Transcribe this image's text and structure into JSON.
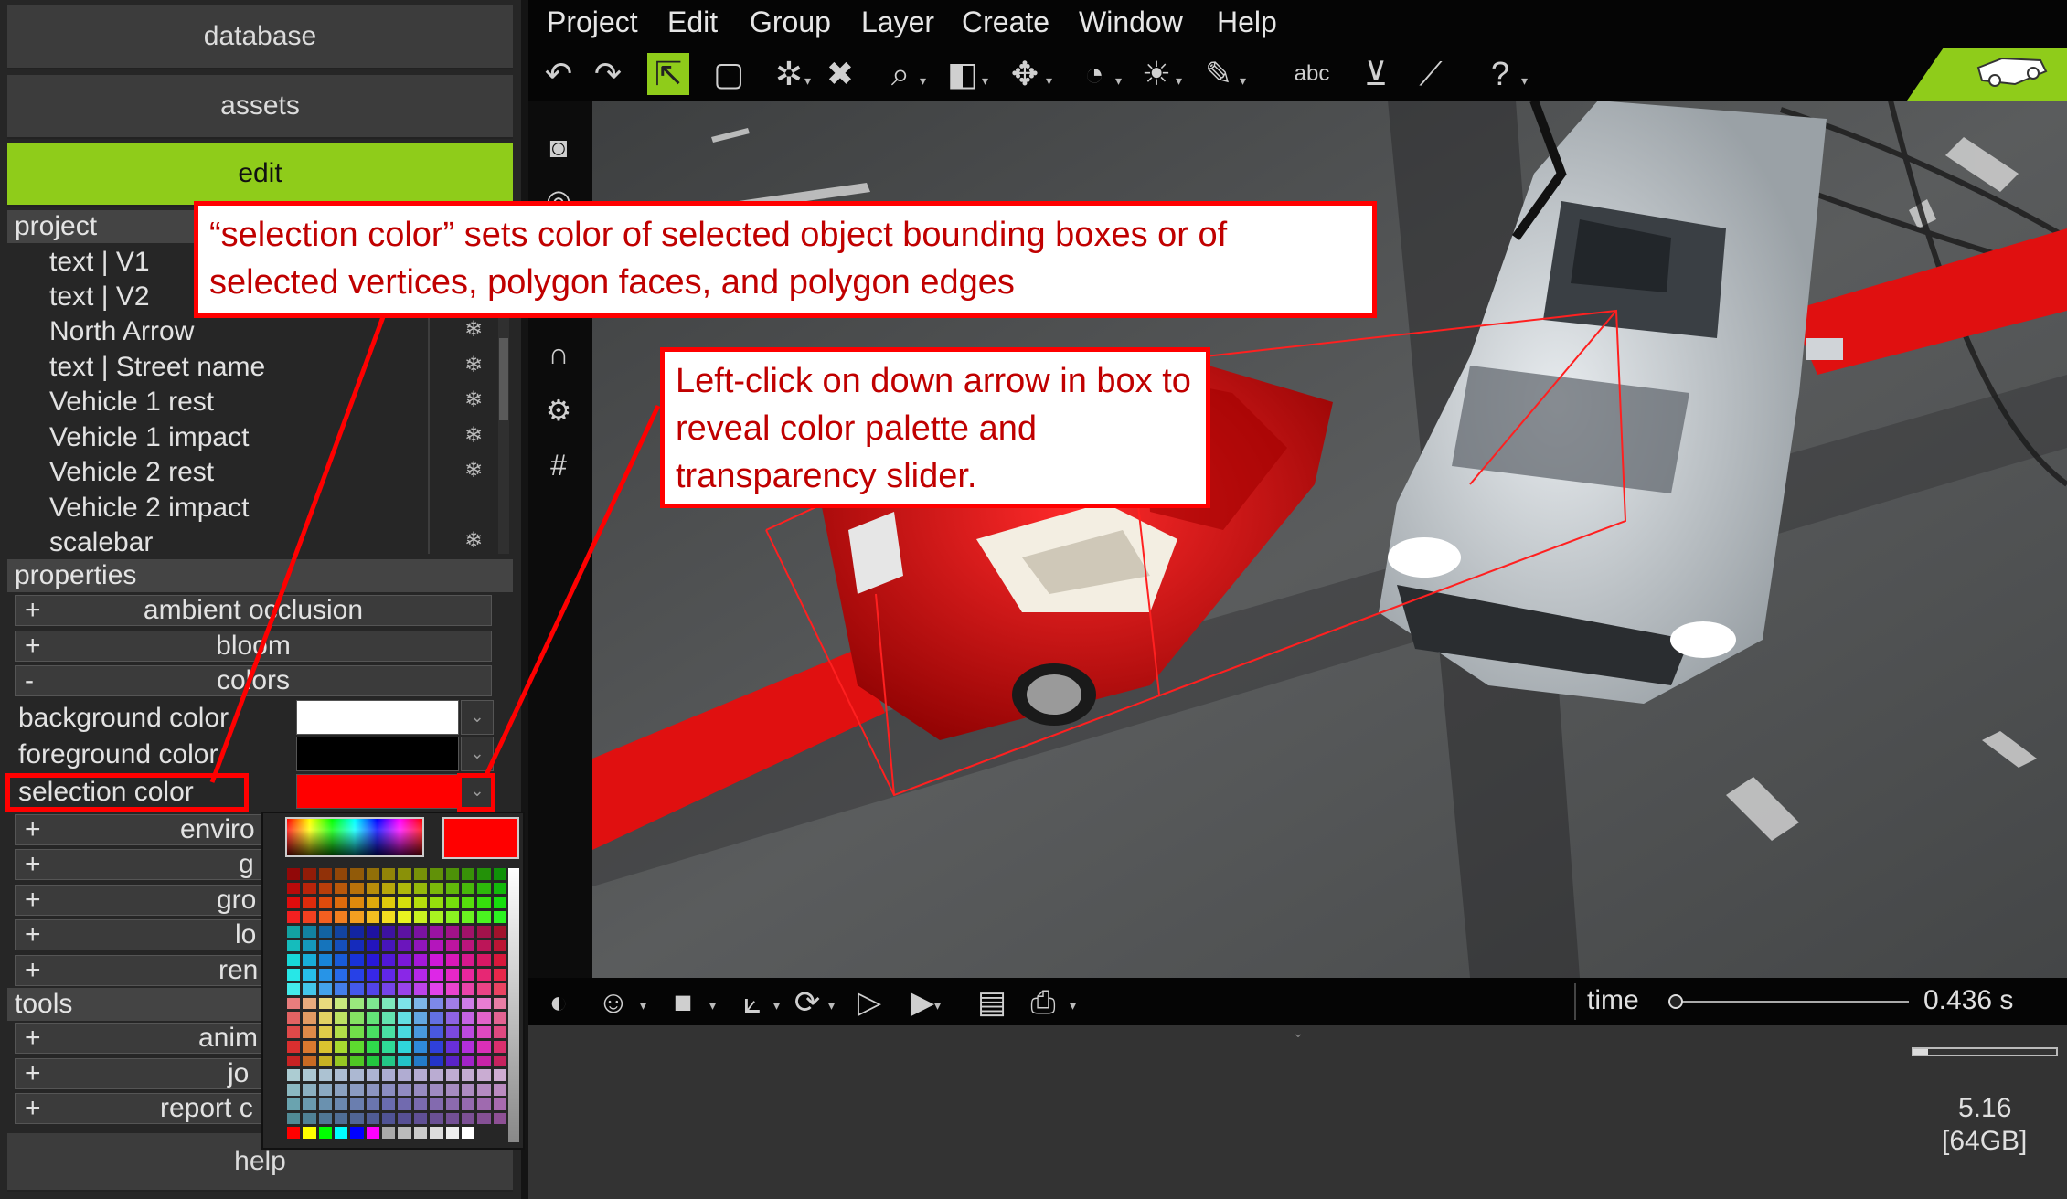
{
  "left_panel": {
    "buttons": {
      "database": "database",
      "assets": "assets",
      "edit": "edit"
    },
    "project_header": "project",
    "project_items": [
      "text | V1",
      "text | V2",
      "North Arrow",
      "text | Street name",
      "Vehicle 1 rest",
      "Vehicle 1 impact",
      "Vehicle 2 rest",
      "Vehicle 2 impact",
      "scalebar"
    ],
    "visibility_icon": "snowflake-icon",
    "properties_header": "properties",
    "prop_sections": [
      {
        "toggle": "+",
        "label": "ambient occlusion"
      },
      {
        "toggle": "+",
        "label": "bloom"
      },
      {
        "toggle": "-",
        "label": "colors"
      }
    ],
    "colors": {
      "background_label": "background color",
      "foreground_label": "foreground color",
      "selection_label": "selection color",
      "background_value": "#ffffff",
      "foreground_value": "#000000",
      "selection_value": "#ff0000"
    },
    "collapsed_sections": [
      {
        "toggle": "+",
        "label": "enviro"
      },
      {
        "toggle": "+",
        "label": "g"
      },
      {
        "toggle": "+",
        "label": "gro"
      },
      {
        "toggle": "+",
        "label": "lo"
      },
      {
        "toggle": "+",
        "label": "ren"
      }
    ],
    "tools_header": "tools",
    "tools_sections": [
      {
        "toggle": "+",
        "label": "anim"
      },
      {
        "toggle": "+",
        "label": "jo"
      },
      {
        "toggle": "+",
        "label": "report c"
      }
    ],
    "help_button": "help"
  },
  "menubar": [
    "Project",
    "Edit",
    "Group",
    "Layer",
    "Create",
    "Window",
    "Help"
  ],
  "toolbar_icons": [
    "undo-icon",
    "redo-icon",
    "select-icon",
    "box-select-icon",
    "vertex-icon",
    "delete-icon",
    "zoom-icon",
    "cube-icon",
    "move-icon",
    "gauge-icon",
    "light-icon",
    "measure-icon",
    "text-icon",
    "polygon-icon",
    "ruler-icon",
    "help-icon"
  ],
  "toolbar_text_icon": "abc",
  "bottom_bar": {
    "time_label": "time",
    "time_value": "0.436 s",
    "time_progress": 0.02
  },
  "status": {
    "version": "5.16",
    "memory": "[64GB]"
  },
  "annotations": {
    "callout1": "“selection color” sets color of selected object bounding boxes or of selected vertices, polygon faces, and polygon edges",
    "callout2": "Left-click on down arrow in box to reveal color palette and transparency slider."
  },
  "palette": {
    "preview_color": "#ff0000"
  },
  "accent_color": "#8fcc1a",
  "annotation_color": "#ff0000"
}
